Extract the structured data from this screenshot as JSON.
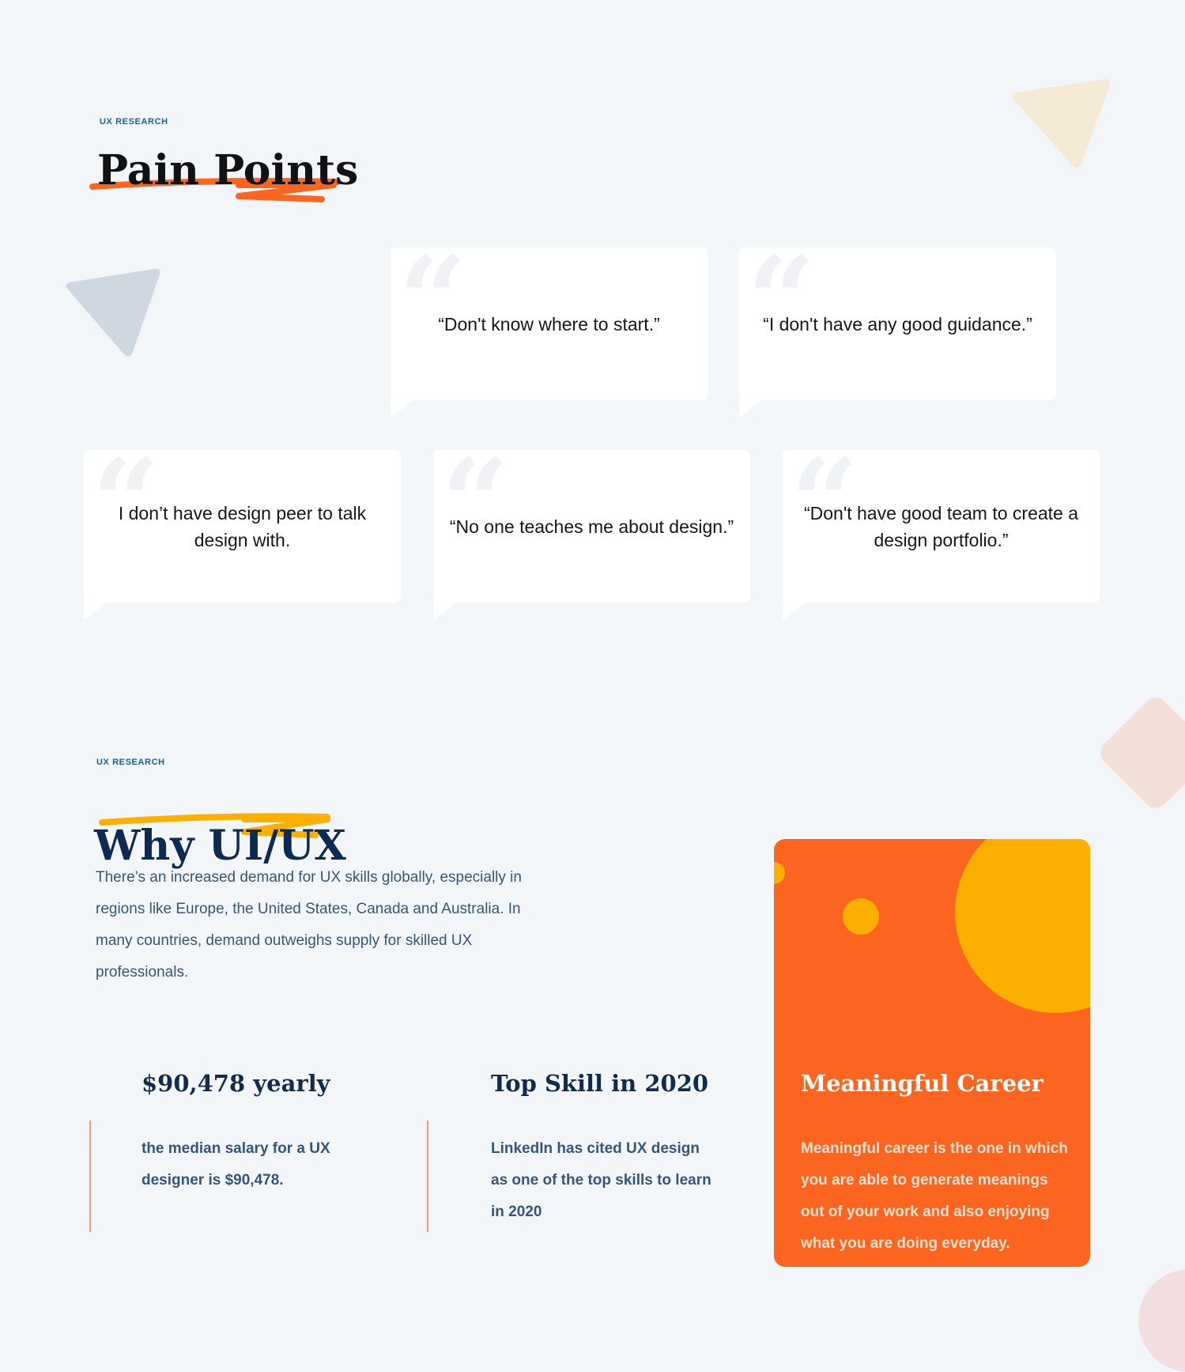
{
  "pain_points": {
    "eyebrow": "UX RESEARCH",
    "title": "Pain Points",
    "quotes": [
      {
        "text": "“Don't know where to start.”"
      },
      {
        "text": "“I don't have any good guidance.”"
      },
      {
        "text": "I don’t have design peer to talk design with."
      },
      {
        "text": "“No one teaches me about design.”"
      },
      {
        "text": "“Don't have good team to create a design portfolio.”"
      }
    ]
  },
  "why_uiux": {
    "eyebrow": "UX RESEARCH",
    "title": "Why UI/UX",
    "intro": "There’s an increased demand for UX skills globally, especially in regions like Europe, the United States, Canada and Australia. In many countries, demand outweighs supply for skilled UX professionals.",
    "stats": [
      {
        "title": "$90,478 yearly",
        "body": "the median salary for a UX designer is $90,478."
      },
      {
        "title": "Top Skill in 2020",
        "body": "LinkedIn has cited UX design as one of the top skills to learn in 2020"
      }
    ],
    "career": {
      "title": "Meaningful Career",
      "body": "Meaningful career is the one in which you are able to generate meanings out of your work and also enjoying what you are doing everyday."
    }
  },
  "colors": {
    "background": "#f3f6f9",
    "accent_orange": "#fb651f",
    "accent_yellow": "#fdaf00",
    "heading_navy": "#0d2b52",
    "body_blue": "#35557a",
    "eyebrow_blue": "#1c5e9a"
  }
}
